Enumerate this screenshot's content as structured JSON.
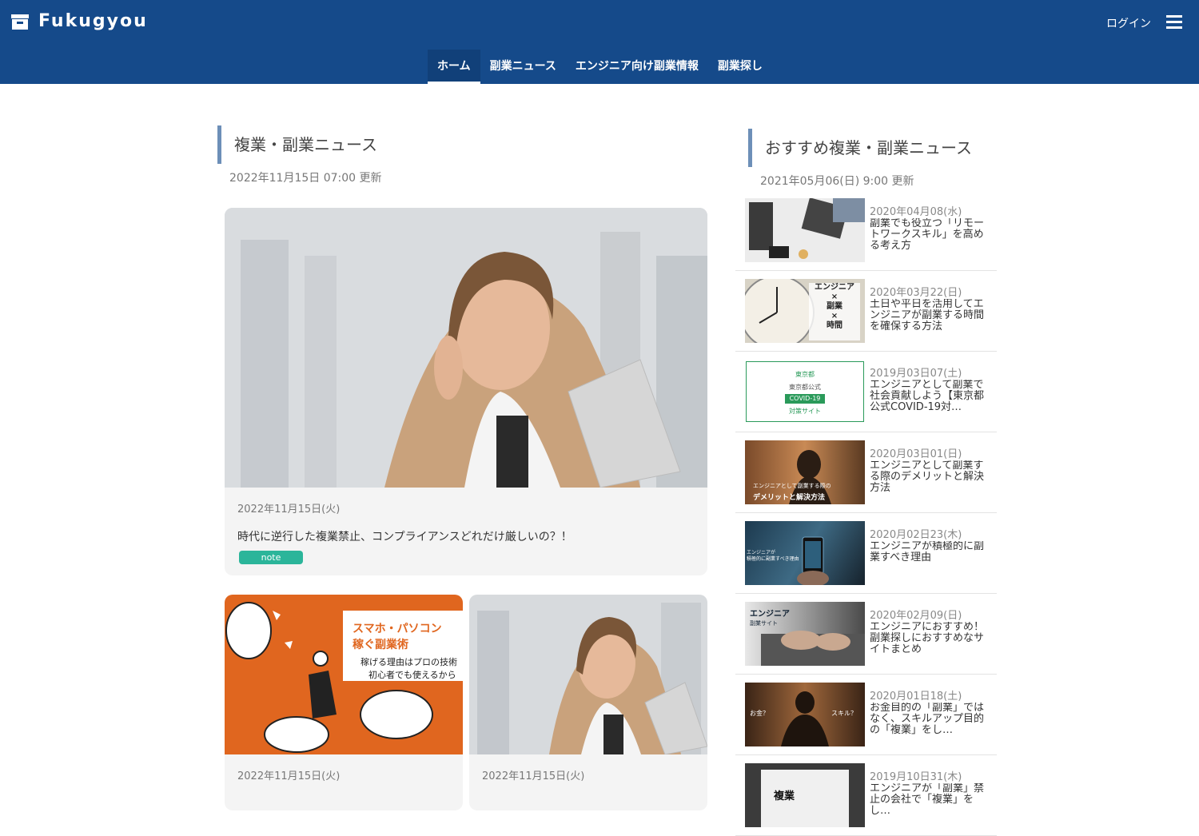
{
  "header": {
    "logo_text": "Fukugyou",
    "login_label": "ログイン",
    "nav": [
      {
        "label": "ホーム"
      },
      {
        "label": "副業ニュース"
      },
      {
        "label": "エンジニア向け副業情報"
      },
      {
        "label": "副業探し"
      }
    ]
  },
  "main": {
    "heading": "複業・副業ニュース",
    "updated": "2022年11月15日 07:00 更新",
    "featured": {
      "date": "2022年11月15日(火)",
      "title": "時代に逆行した複業禁止、コンプライアンスどれだけ厳しいの？！",
      "tag": "note"
    },
    "cards": [
      {
        "date": "2022年11月15日(火)",
        "image_line1": "スマホ・パソコン",
        "image_line2": "稼ぐ副業術",
        "image_line3": "稼げる理由はプロの技術",
        "image_line4": "初心者でも使えるから"
      },
      {
        "date": "2022年11月15日(火)"
      }
    ]
  },
  "sidebar": {
    "heading": "おすすめ複業・副業ニュース",
    "updated": "2021年05月06(日) 9:00 更新",
    "items": [
      {
        "date": "2020年04月08(水)",
        "title": "副業でも役立つ「リモートワークスキル」を高める考え方"
      },
      {
        "date": "2020年03月22(日)",
        "title": "土日や平日を活用してエンジニアが副業する時間を確保する方法",
        "thumb_text": [
          "エンジニア",
          "×",
          "副業",
          "×",
          "時間"
        ]
      },
      {
        "date": "2019月03日07(土)",
        "title": "エンジニアとして副業で社会貢献しよう【東京都公式COVID-19対…",
        "thumb_text": [
          "東京都",
          "東京都公式",
          "COVID-19",
          "対策サイト"
        ]
      },
      {
        "date": "2020月03日01(日)",
        "title": "エンジニアとして副業する際のデメリットと解決方法",
        "thumb_text": [
          "エンジニアとして副業する際の",
          "デメリットと解決方法"
        ]
      },
      {
        "date": "2020月02日23(木)",
        "title": "エンジニアが積極的に副業すべき理由",
        "thumb_text": [
          "エンジニアが",
          "積極的に副業すべき理由"
        ]
      },
      {
        "date": "2020年02月09(日)",
        "title": "エンジニアにおすすめ！副業探しにおすすめなサイトまとめ",
        "thumb_text": [
          "エンジニア",
          "副業サイト"
        ]
      },
      {
        "date": "2020月01日18(土)",
        "title": "お金目的の「副業」ではなく、スキルアップ目的の「複業」をし…",
        "thumb_text": [
          "お金？",
          "スキル？"
        ]
      },
      {
        "date": "2019月10日31(木)",
        "title": "エンジニアが「副業」禁止の会社で「複業」をし…",
        "thumb_text": [
          "複業"
        ]
      }
    ]
  },
  "colors": {
    "header_bg": "#154a8a",
    "accent_bar": "#6d8fb8",
    "tag_bg": "#2bb59a",
    "card_orange": "#e0661f"
  },
  "icons": [
    "archive-box-icon",
    "hamburger-menu-icon"
  ]
}
